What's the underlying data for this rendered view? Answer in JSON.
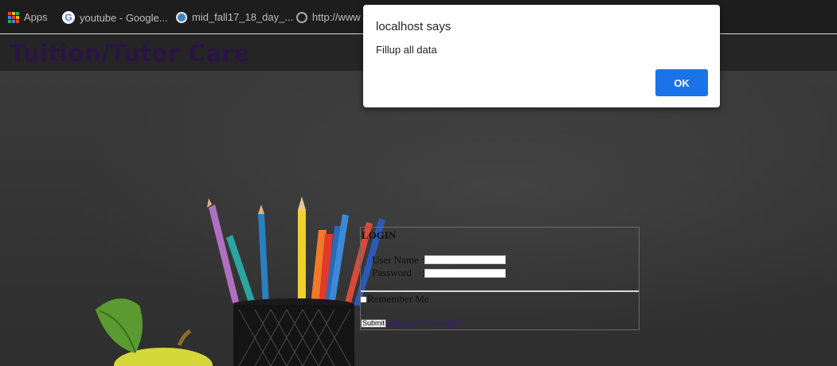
{
  "bookmarks": {
    "items": [
      {
        "label": "Apps",
        "icon": "apps-grid-icon"
      },
      {
        "label": "youtube - Google...",
        "icon": "google-icon"
      },
      {
        "label": "mid_fall17_18_day_...",
        "icon": "blue-ball-icon"
      },
      {
        "label": "http://www",
        "icon": "globe-icon"
      }
    ]
  },
  "site": {
    "title": "Tuition/Tutor Care"
  },
  "login": {
    "title": "LOGIN",
    "username_label": "User Name :",
    "password_label": "Password    :",
    "remember_label": "Remember Me",
    "submit_label": "Submit",
    "forgot_label": "Forgot Password?"
  },
  "dialog": {
    "title": "localhost says",
    "message": "Fillup all data",
    "ok_label": "OK"
  },
  "colors": {
    "dialog_button": "#1a73e8",
    "site_title": "#2a1444",
    "link": "#3a1b8a"
  }
}
